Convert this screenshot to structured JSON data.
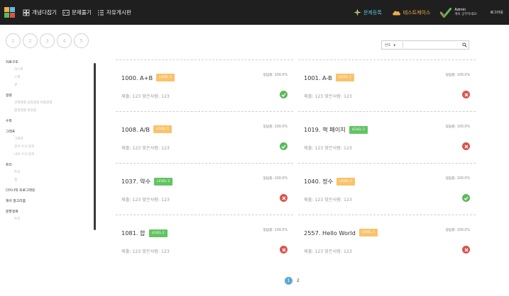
{
  "nav": {
    "items": [
      {
        "label": "개념다잡기",
        "icon": "concept-icon"
      },
      {
        "label": "문제풀기",
        "icon": "code-icon"
      },
      {
        "label": "자유게시판",
        "icon": "list-icon"
      }
    ],
    "right": {
      "register": "문제등록",
      "testcase": "테스트케이스",
      "user_name": "Admin",
      "user_sub": "계속 공부하세요!",
      "logout": "로그아웃"
    },
    "colors": {
      "register": "#5bc0de",
      "testcase": "#f0ad4e",
      "check": "#5cb85c"
    }
  },
  "steps": [
    "1",
    "2",
    "3",
    "4",
    "5"
  ],
  "sidebar": [
    {
      "section": "자료구조",
      "subs": [
        "리스트",
        "스택",
        "큐"
      ]
    },
    {
      "section": "정렬",
      "subs": [
        "선택정렬 삽입정렬 버블정렬",
        "합병정렬 퀵정렬"
      ]
    },
    {
      "section": "수학",
      "subs": []
    },
    {
      "section": "그래프",
      "subs": [
        "그래프",
        "깊이 우선 탐색",
        "너비 우선 탐색"
      ]
    },
    {
      "section": "트리",
      "subs": [
        "트리",
        "힙"
      ]
    },
    {
      "section": "다이나믹 프로그래밍",
      "subs": []
    },
    {
      "section": "재귀 알고리즘",
      "subs": []
    },
    {
      "section": "분할정복",
      "subs": [
        "트리"
      ]
    }
  ],
  "search": {
    "category": "번호",
    "placeholder": ""
  },
  "problems": [
    {
      "title": "1000. A+B",
      "level": "LEVEL 1",
      "rate": "정답률: 100.0%",
      "stats": "제출: 123   맞은사람: 123",
      "status": "ok"
    },
    {
      "title": "1001. A-B",
      "level": "LEVEL 1",
      "rate": "정답률: 100.0%",
      "stats": "제출: 123   맞은사람: 123",
      "status": "no"
    },
    {
      "title": "1008. A/B",
      "level": "LEVEL 1",
      "rate": "정답률: 100.0%",
      "stats": "제출: 123   맞은사람: 123",
      "status": "ok"
    },
    {
      "title": "1019. 책 페이지",
      "level": "LEVEL 2",
      "rate": "정답률: 100.0%",
      "stats": "제출: 123   맞은사람: 123",
      "status": "no"
    },
    {
      "title": "1037. 약수",
      "level": "LEVEL 2",
      "rate": "정답률: 100.0%",
      "stats": "제출: 123   맞은사람: 123",
      "status": "no"
    },
    {
      "title": "1040. 정수",
      "level": "LEVEL 1",
      "rate": "정답률: 100.0%",
      "stats": "제출: 123   맞은사람: 123",
      "status": "ok"
    },
    {
      "title": "1081. 합",
      "level": "LEVEL 2",
      "rate": "정답률: 100.0%",
      "stats": "제출: 123   맞은사람: 123",
      "status": "no"
    },
    {
      "title": "2557. Hello World",
      "level": "LEVEL 1",
      "rate": "정답률: 100.0%",
      "stats": "제출: 123   맞은사람: 123",
      "status": "no"
    }
  ],
  "pagination": {
    "pages": [
      "1",
      "2"
    ],
    "current": "1"
  }
}
